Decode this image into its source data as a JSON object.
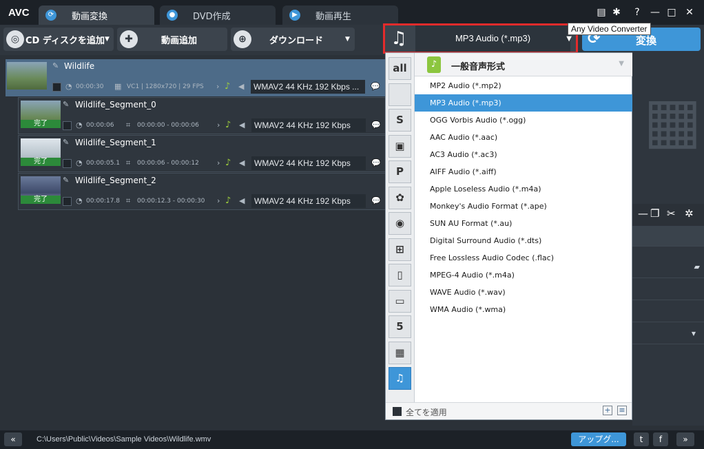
{
  "app": {
    "logo": "AVC"
  },
  "tabs": [
    {
      "label": "動画変換",
      "icon": "refresh-icon"
    },
    {
      "label": "DVD作成",
      "icon": "disc-icon"
    },
    {
      "label": "動画再生",
      "icon": "play-icon"
    }
  ],
  "window_controls": {
    "help": "?"
  },
  "toolbar": {
    "add_cd": "CD ディスクを追加",
    "add_video": "動画追加",
    "download": "ダウンロード",
    "format_value": "MP3 Audio (*.mp3)",
    "convert": "変換",
    "tooltip": "Any Video Converter"
  },
  "files": {
    "main": {
      "name": "Wildlife",
      "duration": "00:00:30",
      "info": "VC1 | 1280x720 | 29 FPS",
      "format": "WMAV2 44 KHz 192 Kbps ..."
    },
    "segments": [
      {
        "name": "Wildlife_Segment_0",
        "status": "完了",
        "duration": "00:00:06",
        "range": "00:00:00 - 00:00:06",
        "format": "WMAV2 44 KHz 192 Kbps"
      },
      {
        "name": "Wildlife_Segment_1",
        "status": "完了",
        "duration": "00:00:05.1",
        "range": "00:00:06 - 00:00:12",
        "format": "WMAV2 44 KHz 192 Kbps"
      },
      {
        "name": "Wildlife_Segment_2",
        "status": "完了",
        "duration": "00:00:17.8",
        "range": "00:00:12.3 - 00:00:30",
        "format": "WMAV2 44 KHz 192 Kbps"
      }
    ]
  },
  "dropdown": {
    "category_title": "一般音声形式",
    "categories": [
      {
        "name": "all",
        "icon": "all-icon",
        "glyph": "all"
      },
      {
        "name": "apple",
        "icon": "apple-icon",
        "glyph": ""
      },
      {
        "name": "android-s",
        "icon": "samsung-android-icon",
        "glyph": "S"
      },
      {
        "name": "android",
        "icon": "android-icon",
        "glyph": "▣"
      },
      {
        "name": "playstation",
        "icon": "playstation-icon",
        "glyph": "P"
      },
      {
        "name": "huawei",
        "icon": "huawei-icon",
        "glyph": "✿"
      },
      {
        "name": "lg",
        "icon": "lg-icon",
        "glyph": "◉"
      },
      {
        "name": "windows",
        "icon": "windows-icon",
        "glyph": "⊞"
      },
      {
        "name": "phone",
        "icon": "phone-icon",
        "glyph": "▯"
      },
      {
        "name": "tv",
        "icon": "tv-icon",
        "glyph": "▭"
      },
      {
        "name": "html5",
        "icon": "html5-icon",
        "glyph": "5"
      },
      {
        "name": "video",
        "icon": "film-icon",
        "glyph": "▦"
      },
      {
        "name": "audio",
        "icon": "music-note-icon",
        "glyph": "♫"
      }
    ],
    "options": [
      "MP2 Audio (*.mp2)",
      "MP3 Audio (*.mp3)",
      "OGG Vorbis Audio (*.ogg)",
      "AAC Audio (*.aac)",
      "AC3 Audio (*.ac3)",
      "AIFF Audio (*.aiff)",
      "Apple Loseless Audio (*.m4a)",
      "Monkey's Audio Format (*.ape)",
      "SUN AU Format (*.au)",
      "Digital Surround Audio (*.dts)",
      "Free Lossless Audio Codec (.flac)",
      "MPEG-4 Audio (*.m4a)",
      "WAVE Audio (*.wav)",
      "WMA Audio (*.wma)"
    ],
    "selected_index": 1,
    "apply_all": "全てを適用"
  },
  "status": {
    "path": "C:\\Users\\Public\\Videos\\Sample Videos\\Wildlife.wmv",
    "upgrade": "アップグ..."
  },
  "colors": {
    "accent": "#3e96d8",
    "highlight_border": "#e52b2b"
  }
}
